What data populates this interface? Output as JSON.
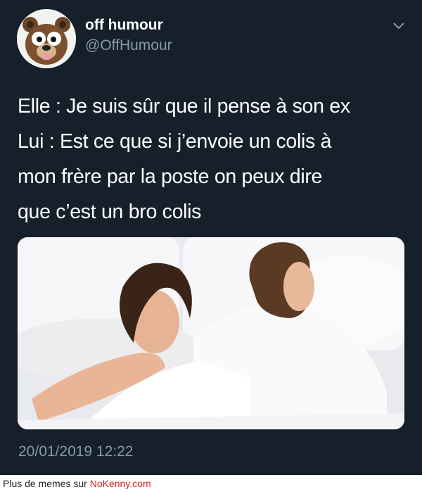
{
  "tweet": {
    "display_name": "off humour",
    "handle": "@OffHumour",
    "avatar_icon": "bear-mascot-avatar",
    "menu_icon": "chevron-down-icon",
    "text_lines": [
      "Elle : Je suis sûr que il pense à son ex",
      "Lui : Est ce que si j’envoie un colis à",
      "mon frère par la poste on peux dire",
      "que c’est un bro colis"
    ],
    "photo": "couple-in-bed-photo",
    "timestamp": "20/01/2019 12:22"
  },
  "footer": {
    "prefix": "Plus de memes sur ",
    "site": "NoKenny.com"
  },
  "colors": {
    "background": "#15202b",
    "primary_text": "#ffffff",
    "secondary_text": "#8899a6",
    "footer_link": "#d62020"
  }
}
